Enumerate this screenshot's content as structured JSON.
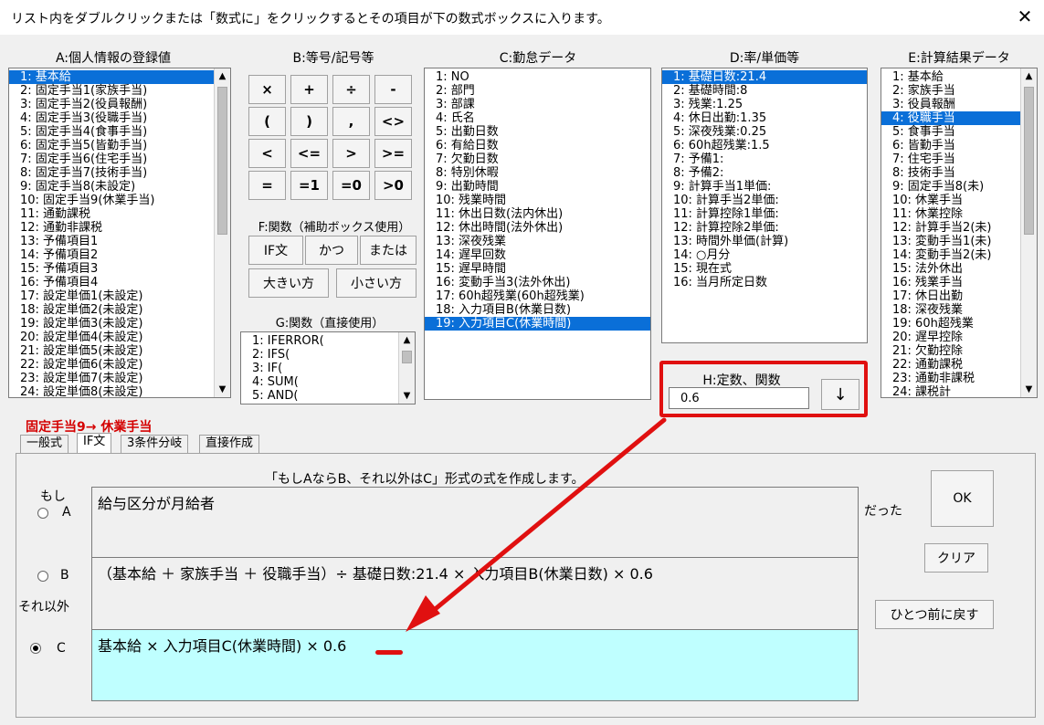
{
  "window": {
    "title": "リスト内をダブルクリックまたは「数式に」をクリックするとその項目が下の数式ボックスに入ります。",
    "close": "✕"
  },
  "sections": {
    "a_title": "A:個人情報の登録値",
    "b_title": "B:等号/記号等",
    "c_title": "C:勤怠データ",
    "d_title": "D:率/単価等",
    "e_title": "E:計算結果データ",
    "f_title": "F:関数（補助ボックス使用）",
    "g_title": "G:関数（直接使用）",
    "h_title": "H:定数、関数"
  },
  "list_a": [
    "1: 基本給",
    "2: 固定手当1(家族手当)",
    "3: 固定手当2(役員報酬)",
    "4: 固定手当3(役職手当)",
    "5: 固定手当4(食事手当)",
    "6: 固定手当5(皆勤手当)",
    "7: 固定手当6(住宅手当)",
    "8: 固定手当7(技術手当)",
    "9: 固定手当8(未設定)",
    "10: 固定手当9(休業手当)",
    "11: 通勤課税",
    "12: 通勤非課税",
    "13: 予備項目1",
    "14: 予備項目2",
    "15: 予備項目3",
    "16: 予備項目4",
    "17: 設定単価1(未設定)",
    "18: 設定単価2(未設定)",
    "19: 設定単価3(未設定)",
    "20: 設定単価4(未設定)",
    "21: 設定単価5(未設定)",
    "22: 設定単価6(未設定)",
    "23: 設定単価7(未設定)",
    "24: 設定単価8(未設定)"
  ],
  "ops": [
    "×",
    "+",
    "÷",
    "-",
    "(",
    ")",
    ",",
    "<>",
    "<",
    "<=",
    ">",
    ">=",
    "=",
    "=1",
    "=0",
    ">0"
  ],
  "func_buttons": [
    "IF文",
    "かつ",
    "または",
    "大きい方",
    "小さい方"
  ],
  "list_g": [
    "1: IFERROR(",
    "2: IFS(",
    "3: IF(",
    "4: SUM(",
    "5: AND("
  ],
  "list_c": [
    "1: NO",
    "2: 部門",
    "3: 部課",
    "4: 氏名",
    "5: 出勤日数",
    "6: 有給日数",
    "7: 欠勤日数",
    "8: 特別休暇",
    "9: 出勤時間",
    "10: 残業時間",
    "11: 休出日数(法内休出)",
    "12: 休出時間(法外休出)",
    "13: 深夜残業",
    "14: 遅早回数",
    "15: 遅早時間",
    "16: 変動手当3(法外休出)",
    "17: 60h超残業(60h超残業)",
    "18: 入力項目B(休業日数)",
    "19: 入力項目C(休業時間)"
  ],
  "list_d": [
    "1: 基礎日数:21.4",
    "2: 基礎時間:8",
    "3: 残業:1.25",
    "4: 休日出勤:1.35",
    "5: 深夜残業:0.25",
    "6: 60h超残業:1.5",
    "7: 予備1:",
    "8: 予備2:",
    "9: 計算手当1単価:",
    "10: 計算手当2単価:",
    "11: 計算控除1単価:",
    "12: 計算控除2単価:",
    "13: 時間外単価(計算)",
    "14: ○月分",
    "15: 現在式",
    "16: 当月所定日数"
  ],
  "list_e": [
    "1: 基本給",
    "2: 家族手当",
    "3: 役員報酬",
    "4: 役職手当",
    "5: 食事手当",
    "6: 皆勤手当",
    "7: 住宅手当",
    "8: 技術手当",
    "9: 固定手当8(未)",
    "10: 休業手当",
    "11: 休業控除",
    "12: 計算手当2(未)",
    "13: 変動手当1(未)",
    "14: 変動手当2(未)",
    "15: 法外休出",
    "16: 残業手当",
    "17: 休日出勤",
    "18: 深夜残業",
    "19: 60h超残業",
    "20: 遅早控除",
    "21: 欠勤控除",
    "22: 通勤課税",
    "23: 通勤非課税",
    "24: 課税計"
  ],
  "constant": {
    "value": "0.6",
    "insert_icon": "↓"
  },
  "current_item": "固定手当9→ 休業手当",
  "tabs": [
    "一般式",
    "IF文",
    "3条件分岐",
    "直接作成"
  ],
  "if_panel": {
    "instruction": "「もしAならB、それ以外はC」形式の式を作成します。",
    "moshi": "もし",
    "a_label": "A",
    "b_label": "B",
    "c_label": "C",
    "sore_igai": "それ以外",
    "datta": "だった",
    "formula_a": "給与区分が月給者",
    "formula_b": "（基本給 ＋ 家族手当 ＋ 役職手当）÷ 基礎日数:21.4 × 入力項目B(休業日数) × 0.6",
    "formula_c_prefix": "基本給 × 入力項目C(休業時間) × ",
    "formula_c_value": "0.6"
  },
  "buttons": {
    "ok": "OK",
    "clear": "クリア",
    "undo": "ひとつ前に戻す"
  },
  "colors": {
    "selection": "#0a6fd8",
    "highlight": "#e01010",
    "formula_c_bg": "#bfffff",
    "current_item": "#d40000"
  }
}
